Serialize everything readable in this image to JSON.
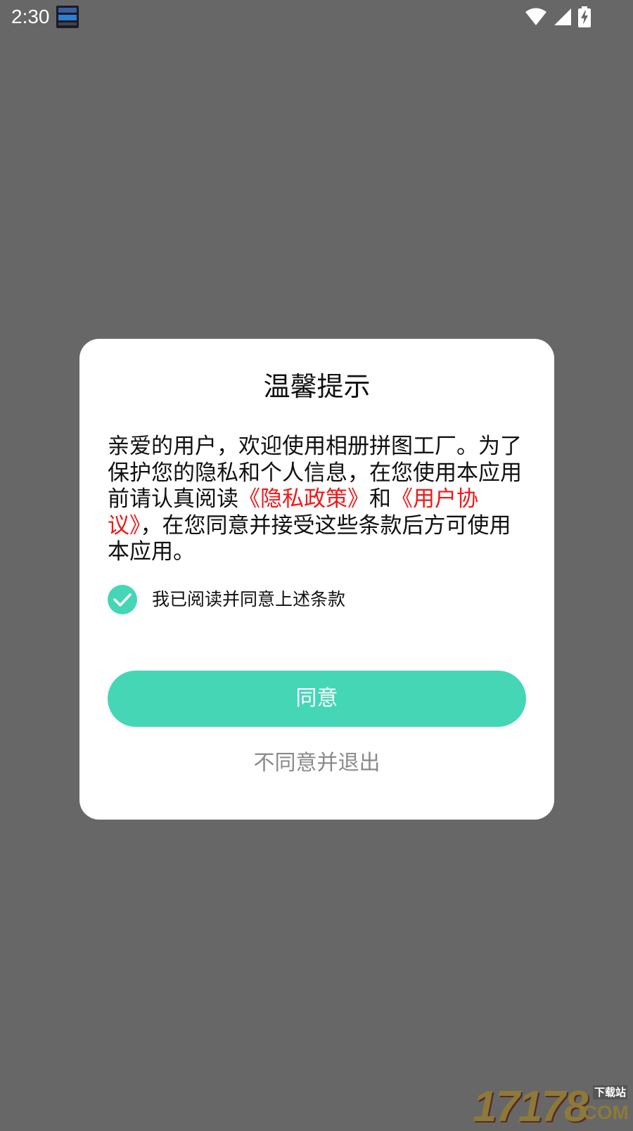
{
  "status_bar": {
    "time": "2:30",
    "notification_icon": "app-notification-icon",
    "icons": [
      "wifi-icon",
      "cellular-signal-icon",
      "battery-charging-icon"
    ]
  },
  "dialog": {
    "title": "温馨提示",
    "body_parts": {
      "intro": "亲爱的用户，欢迎使用相册拼图工厂。为了保护您的隐私和个人信息，在您使用本应用前请认真阅读",
      "privacy_link": "《隐私政策》",
      "and": "和",
      "agreement_link": "《用户协议》",
      "outro": "，在您同意并接受这些条款后方可使用本应用。"
    },
    "checkbox": {
      "checked": true,
      "label": "我已阅读并同意上述条款"
    },
    "agree_button": "同意",
    "decline_link": "不同意并退出"
  },
  "watermark": {
    "number": "17178",
    "sub": "下载站",
    "domain": ".COM"
  },
  "colors": {
    "accent": "#45d6b6",
    "link": "#f01818",
    "overlay": "#676767",
    "secondary_text": "#8a8a8a"
  }
}
